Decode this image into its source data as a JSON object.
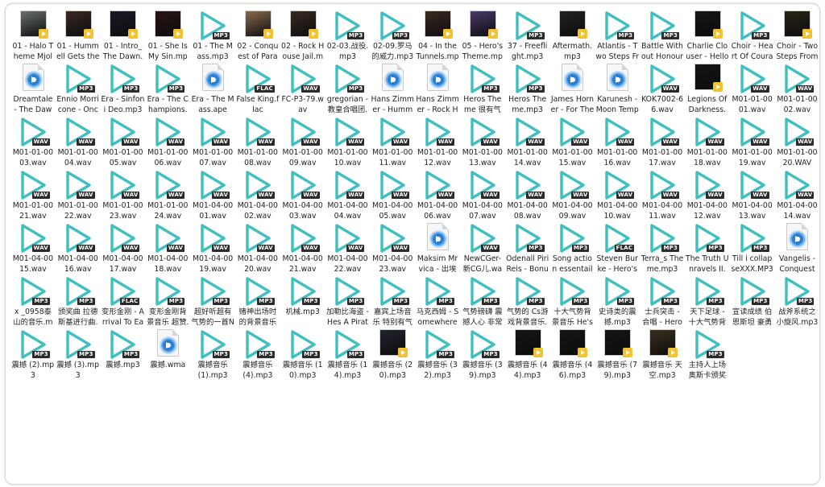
{
  "colors": {
    "play_icon": "#3fbfbf",
    "badge": "#2b2b2b",
    "art_badge": "#f2c230"
  },
  "files": [
    {
      "name": "01 - Halo Theme Mjolnir Mix.mp3",
      "icon": "album-art",
      "art": "#6b6f70"
    },
    {
      "name": "01 - Hummell Gets the Rockets....",
      "icon": "album-art",
      "art": "#3a2a22"
    },
    {
      "name": "01 - Intro_ The Dawn.mp3",
      "icon": "album-art",
      "art": "#1a1a28"
    },
    {
      "name": "01 - She Is My Sin.mp3",
      "icon": "album-art",
      "art": "#2a1414"
    },
    {
      "name": "01 - The Mass.mp3",
      "icon": "play",
      "badge": "MP3"
    },
    {
      "name": "02 - Conquest of Paradise....",
      "icon": "album-art",
      "art": "#8a6a50"
    },
    {
      "name": "02 - Rock House Jail.mp3",
      "icon": "album-art",
      "art": "#3a2a22"
    },
    {
      "name": "02-03.战役.mp3",
      "icon": "play",
      "badge": "MP3"
    },
    {
      "name": "02-09.罗马的威力.mp3",
      "icon": "play",
      "badge": "MP3"
    },
    {
      "name": "04 - In the Tunnels.mp3",
      "icon": "album-art",
      "art": "#3a2a22"
    },
    {
      "name": "05 - Hero's Theme.mp3",
      "icon": "album-art",
      "art": "#4a3a6a"
    },
    {
      "name": "37 - Freeflight.mp3",
      "icon": "play",
      "badge": "MP3"
    },
    {
      "name": "Aftermath.mp3",
      "icon": "album-art",
      "art": "#222222"
    },
    {
      "name": "Atlantis - Two Steps From Hell.mp3",
      "icon": "play",
      "badge": "MP3"
    },
    {
      "name": "Battle Without Honour Or Hum...",
      "icon": "play",
      "badge": "MP3"
    },
    {
      "name": "Charlie Clouser - Hello Zepp.mp3",
      "icon": "album-art",
      "art": "#151515"
    },
    {
      "name": "Choir - Heart Of Courage.mp3",
      "icon": "play",
      "badge": "MP3"
    },
    {
      "name": "Choir - Two Steps From Hell.mp3",
      "icon": "album-art",
      "art": "#2a2418"
    },
    {
      "name": "Dreamtale - The Dawn.ape",
      "icon": "doc"
    },
    {
      "name": "Ennio Morricone - Once Upon A ...",
      "icon": "play",
      "badge": "MP3"
    },
    {
      "name": "Era - Sinfoni Deo.mp3",
      "icon": "play",
      "badge": "MP3"
    },
    {
      "name": "Era - The Champions.mp3",
      "icon": "play",
      "badge": "MP3"
    },
    {
      "name": "Era - The Mass.ape",
      "icon": "doc"
    },
    {
      "name": "False King.flac",
      "icon": "play",
      "badge": "FLAC"
    },
    {
      "name": "FC-P3-79.wav",
      "icon": "play",
      "badge": "WAV"
    },
    {
      "name": "gregorian - 教皇合唱团.mp3",
      "icon": "play",
      "badge": "MP3"
    },
    {
      "name": "Hans Zimmer - Hummell Gets Th...",
      "icon": "doc"
    },
    {
      "name": "Hans Zimmer - Rock House J...",
      "icon": "doc"
    },
    {
      "name": "Heros Theme 很有气势的一首曲子.m...",
      "icon": "play",
      "badge": "MP3"
    },
    {
      "name": "Heros Theme.mp3",
      "icon": "play",
      "badge": "MP3"
    },
    {
      "name": "James Horner - For The Love Of ...",
      "icon": "doc"
    },
    {
      "name": "Karunesh - Moon Temple.ape",
      "icon": "doc"
    },
    {
      "name": "KOK7002-66.wav",
      "icon": "play",
      "badge": "WAV"
    },
    {
      "name": "Legions Of Darkness.mp3",
      "icon": "album-art",
      "art": "#141414"
    },
    {
      "name": "M01-01-0001.wav",
      "icon": "play",
      "badge": "WAV"
    },
    {
      "name": "M01-01-0002.wav",
      "icon": "play",
      "badge": "WAV"
    },
    {
      "name": "M01-01-0003.wav",
      "icon": "play",
      "badge": "WAV"
    },
    {
      "name": "M01-01-0004.wav",
      "icon": "play",
      "badge": "WAV"
    },
    {
      "name": "M01-01-0005.wav",
      "icon": "play",
      "badge": "WAV"
    },
    {
      "name": "M01-01-0006.wav",
      "icon": "play",
      "badge": "WAV"
    },
    {
      "name": "M01-01-0007.wav",
      "icon": "play",
      "badge": "WAV"
    },
    {
      "name": "M01-01-0008.wav",
      "icon": "play",
      "badge": "WAV"
    },
    {
      "name": "M01-01-0009.wav",
      "icon": "play",
      "badge": "WAV"
    },
    {
      "name": "M01-01-0010.wav",
      "icon": "play",
      "badge": "WAV"
    },
    {
      "name": "M01-01-0011.wav",
      "icon": "play",
      "badge": "WAV"
    },
    {
      "name": "M01-01-0012.wav",
      "icon": "play",
      "badge": "WAV"
    },
    {
      "name": "M01-01-0013.wav",
      "icon": "play",
      "badge": "WAV"
    },
    {
      "name": "M01-01-0014.wav",
      "icon": "play",
      "badge": "WAV"
    },
    {
      "name": "M01-01-0015.wav",
      "icon": "play",
      "badge": "WAV"
    },
    {
      "name": "M01-01-0016.wav",
      "icon": "play",
      "badge": "WAV"
    },
    {
      "name": "M01-01-0017.wav",
      "icon": "play",
      "badge": "WAV"
    },
    {
      "name": "M01-01-0018.wav",
      "icon": "play",
      "badge": "WAV"
    },
    {
      "name": "M01-01-0019.wav",
      "icon": "play",
      "badge": "WAV"
    },
    {
      "name": "M01-01-0020.WAV",
      "icon": "play",
      "badge": "WAV"
    },
    {
      "name": "M01-01-0021.wav",
      "icon": "play",
      "badge": "WAV"
    },
    {
      "name": "M01-01-0022.wav",
      "icon": "play",
      "badge": "WAV"
    },
    {
      "name": "M01-01-0023.wav",
      "icon": "play",
      "badge": "WAV"
    },
    {
      "name": "M01-01-0024.wav",
      "icon": "play",
      "badge": "WAV"
    },
    {
      "name": "M01-04-0001.wav",
      "icon": "play",
      "badge": "WAV"
    },
    {
      "name": "M01-04-0002.wav",
      "icon": "play",
      "badge": "WAV"
    },
    {
      "name": "M01-04-0003.wav",
      "icon": "play",
      "badge": "WAV"
    },
    {
      "name": "M01-04-0004.wav",
      "icon": "play",
      "badge": "WAV"
    },
    {
      "name": "M01-04-0005.wav",
      "icon": "play",
      "badge": "WAV"
    },
    {
      "name": "M01-04-0006.wav",
      "icon": "play",
      "badge": "WAV"
    },
    {
      "name": "M01-04-0007.wav",
      "icon": "play",
      "badge": "WAV"
    },
    {
      "name": "M01-04-0008.wav",
      "icon": "play",
      "badge": "WAV"
    },
    {
      "name": "M01-04-0009.wav",
      "icon": "play",
      "badge": "WAV"
    },
    {
      "name": "M01-04-0010.wav",
      "icon": "play",
      "badge": "WAV"
    },
    {
      "name": "M01-04-0011.wav",
      "icon": "play",
      "badge": "WAV"
    },
    {
      "name": "M01-04-0012.wav",
      "icon": "play",
      "badge": "WAV"
    },
    {
      "name": "M01-04-0013.wav",
      "icon": "play",
      "badge": "WAV"
    },
    {
      "name": "M01-04-0014.wav",
      "icon": "play",
      "badge": "WAV"
    },
    {
      "name": "M01-04-0015.wav",
      "icon": "play",
      "badge": "WAV"
    },
    {
      "name": "M01-04-0016.wav",
      "icon": "play",
      "badge": "WAV"
    },
    {
      "name": "M01-04-0017.wav",
      "icon": "play",
      "badge": "WAV"
    },
    {
      "name": "M01-04-0018.wav",
      "icon": "play",
      "badge": "WAV"
    },
    {
      "name": "M01-04-0019.wav",
      "icon": "play",
      "badge": "WAV"
    },
    {
      "name": "M01-04-0020.wav",
      "icon": "play",
      "badge": "WAV"
    },
    {
      "name": "M01-04-0021.wav",
      "icon": "play",
      "badge": "WAV"
    },
    {
      "name": "M01-04-0022.wav",
      "icon": "play",
      "badge": "WAV"
    },
    {
      "name": "M01-04-0023.wav",
      "icon": "play",
      "badge": "WAV"
    },
    {
      "name": "Maksim Mrvica - 出埃及记.ape",
      "icon": "doc"
    },
    {
      "name": "NewCGer-新CG儿.wav",
      "icon": "play",
      "badge": "WAV"
    },
    {
      "name": "Odenall Piri Reis - Bonus Track.mp3",
      "icon": "play",
      "badge": "MP3"
    },
    {
      "name": "Song action essentails.mp3",
      "icon": "play",
      "badge": "MP3"
    },
    {
      "name": "Steven Burke - Hero's Theme.f...",
      "icon": "play",
      "badge": "FLAC"
    },
    {
      "name": "Terra_s Theme.mp3",
      "icon": "play",
      "badge": "MP3"
    },
    {
      "name": "The Truth Unravels II.mp3",
      "icon": "play",
      "badge": "MP3"
    },
    {
      "name": "Till i collapseXXX.MP3",
      "icon": "play",
      "badge": "MP3"
    },
    {
      "name": "Vangelis - Conquest Of Paradise....",
      "icon": "doc"
    },
    {
      "name": "x _0958泰山的音乐.mp3",
      "icon": "play",
      "badge": "MP3"
    },
    {
      "name": "颁奖曲 拉德斯基进行曲.mp3",
      "icon": "play",
      "badge": "MP3"
    },
    {
      "name": "变形金刚 - Arrival To Earth.flac",
      "icon": "play",
      "badge": "FLAC"
    },
    {
      "name": "变形金刚背景音乐 超赞.mp3",
      "icon": "play",
      "badge": "MP3"
    },
    {
      "name": "超好听超有气势的一首Newage.mp3",
      "icon": "play",
      "badge": "MP3"
    },
    {
      "name": "赌神出场时的背景音乐 震撼人心 手机铃声...",
      "icon": "play",
      "badge": "MP3"
    },
    {
      "name": "机械.mp3",
      "icon": "play",
      "badge": "MP3"
    },
    {
      "name": "加勒比海盗 - Hes A Pirate.mp3",
      "icon": "play",
      "badge": "MP3"
    },
    {
      "name": "嘉宾上场音乐 特别有气势 也可用于颁奖...",
      "icon": "play",
      "badge": "MP3"
    },
    {
      "name": "马克西姆 - Somewhere In Time.mp3",
      "icon": "play",
      "badge": "MP3"
    },
    {
      "name": "气势磅礴 震撼人心 非常大气的背景音乐...",
      "icon": "play",
      "badge": "MP3"
    },
    {
      "name": "气势的 Cs游戏背景音乐.mp3",
      "icon": "play",
      "badge": "MP3"
    },
    {
      "name": "十大气势背景音乐 He's A Pirate.m...",
      "icon": "play",
      "badge": "MP3"
    },
    {
      "name": "史诗类的震撼.mp3",
      "icon": "play",
      "badge": "MP3"
    },
    {
      "name": "士兵突击 - 合唱 - Heros Theme ...",
      "icon": "play",
      "badge": "MP3"
    },
    {
      "name": "天下足球 - 十大气势背景音乐.mp3",
      "icon": "play",
      "badge": "MP3"
    },
    {
      "name": "宣读成绩 伯恩斯坦 豪勇七蛟龙.mp3",
      "icon": "play",
      "badge": "MP3"
    },
    {
      "name": "战斧系统之小旋风.mp3",
      "icon": "play",
      "badge": "MP3"
    },
    {
      "name": "震撼 (2).mp3",
      "icon": "play",
      "badge": "MP3"
    },
    {
      "name": "震撼 (3).mp3",
      "icon": "play",
      "badge": "MP3"
    },
    {
      "name": "震撼.mp3",
      "icon": "play",
      "badge": "MP3"
    },
    {
      "name": "震撼.wma",
      "icon": "doc"
    },
    {
      "name": "震撼音乐 (1).mp3",
      "icon": "play",
      "badge": "MP3"
    },
    {
      "name": "震撼音乐 (4).mp3",
      "icon": "play",
      "badge": "MP3"
    },
    {
      "name": "震撼音乐 (10).mp3",
      "icon": "play",
      "badge": "MP3"
    },
    {
      "name": "震撼音乐 (14).mp3",
      "icon": "play",
      "badge": "MP3"
    },
    {
      "name": "震撼音乐 (20).mp3",
      "icon": "album-art",
      "art": "#20242c"
    },
    {
      "name": "震撼音乐 (32).mp3",
      "icon": "play",
      "badge": "MP3"
    },
    {
      "name": "震撼音乐 (39).mp3",
      "icon": "play",
      "badge": "MP3"
    },
    {
      "name": "震撼音乐 (44).mp3",
      "icon": "album-art",
      "art": "#151515"
    },
    {
      "name": "震撼音乐 (46).mp3",
      "icon": "album-art",
      "art": "#151515"
    },
    {
      "name": "震撼音乐 (79).mp3",
      "icon": "album-art",
      "art": "#151515"
    },
    {
      "name": "震撼音乐 天空.mp3",
      "icon": "album-art",
      "art": "#3a3020"
    },
    {
      "name": "主持人上场 奥斯卡颁奖进行曲.mp3",
      "icon": "play",
      "badge": "MP3"
    }
  ]
}
